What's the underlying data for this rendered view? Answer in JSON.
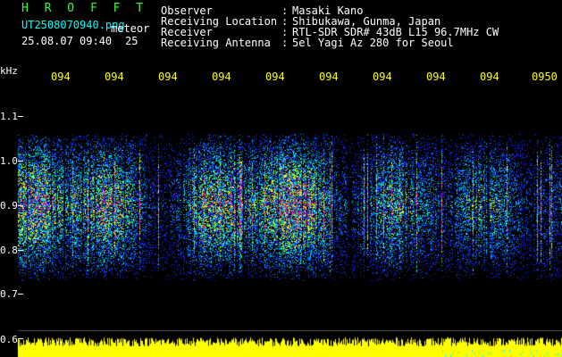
{
  "header": {
    "app": "H R O F F T",
    "filename": "UT2508070940.png",
    "meteor_label": "meteor",
    "datetime": "25.08.07 09:40",
    "count": "25",
    "fields": [
      {
        "label": "Observer",
        "sep": ":",
        "value": "Masaki Kano"
      },
      {
        "label": "Receiving Location",
        "sep": ":",
        "value": "Shibukawa, Gunma, Japan"
      },
      {
        "label": "Receiver",
        "sep": ":",
        "value": "RTL-SDR SDR# 43dB L15 96.7MHz CW"
      },
      {
        "label": "Receiving Antenna",
        "sep": ":",
        "value": "5el Yagi Az 280 for Seoul"
      }
    ]
  },
  "axis": {
    "unit": "kHz",
    "y_ticks": [
      "1.1",
      "1.0",
      "0.9",
      "0.8",
      "0.7",
      "0.6"
    ],
    "x_ticks": [
      "094",
      "094",
      "094",
      "094",
      "094",
      "094",
      "094",
      "094",
      "094",
      "0950"
    ]
  },
  "colors": {
    "background": "#000000",
    "low": "#1a2bff",
    "mid": "#00ffcc",
    "high": "#ff1493",
    "power": "#ffff00",
    "title": "#33ff33"
  }
}
